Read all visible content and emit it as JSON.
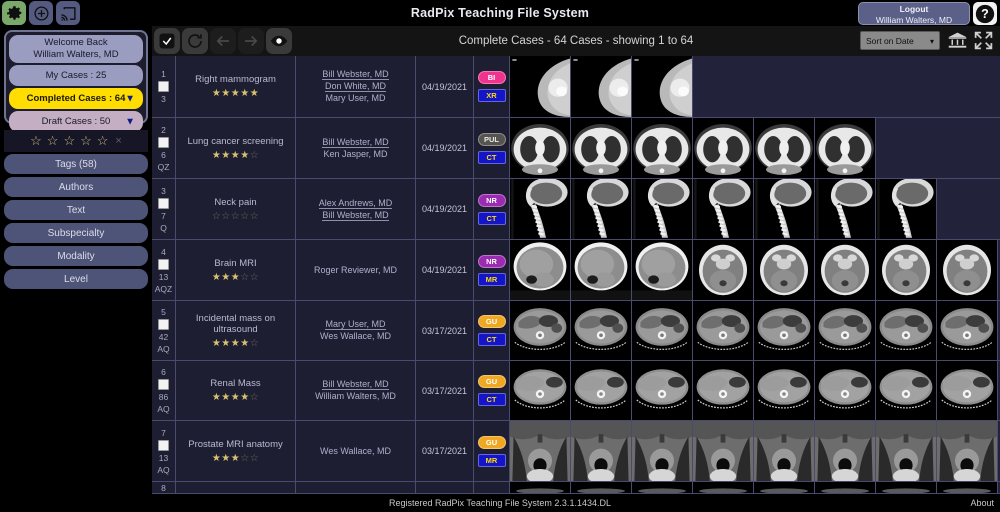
{
  "header": {
    "title": "RadPix Teaching File System",
    "icons": [
      "gear-icon",
      "add-circle-icon",
      "cast-icon"
    ],
    "logout_label": "Logout",
    "logout_user": "William Walters, MD",
    "help_label": "?"
  },
  "sidebar": {
    "welcome_line1": "Welcome Back",
    "welcome_line2": "William Walters, MD",
    "my_cases": "My Cases : 25",
    "completed_cases": "Completed Cases : 64",
    "draft_cases": "Draft Cases : 50",
    "rating_stars": 5,
    "clear_rating": "×",
    "filters": [
      {
        "label": "Tags (58)"
      },
      {
        "label": "Authors"
      },
      {
        "label": "Text"
      },
      {
        "label": "Subspecialty"
      },
      {
        "label": "Modality"
      },
      {
        "label": "Level"
      }
    ]
  },
  "toolbar": {
    "title": "Complete Cases - 64 Cases - showing 1 to 64",
    "sort_label": "Sort on Date",
    "buttons": [
      "select-all-icon",
      "refresh-icon",
      "back-arrow-icon",
      "forward-arrow-icon",
      "preview-eye-icon"
    ],
    "right_buttons": [
      "bank-icon",
      "fullscreen-icon"
    ]
  },
  "colors": {
    "accent_yellow": "#ffdd00",
    "badge_bi": "#f0338f",
    "badge_xr": "#1414c8",
    "badge_pul": "#55544e",
    "badge_ct": "#1414c8",
    "badge_nr": "#9b2bb0",
    "badge_mr": "#1414c8",
    "badge_gu": "#f0a823",
    "row_bg": "#23233c",
    "grid": "#4a4a6e"
  },
  "rows": [
    {
      "num": "1",
      "count": "3",
      "flags": "",
      "title": "Right mammogram",
      "stars": 5,
      "authors": [
        {
          "name": "Bill Webster, MD",
          "underline": true
        },
        {
          "name": "Don White, MD",
          "underline": true
        },
        {
          "name": "Mary User, MD",
          "underline": false
        }
      ],
      "date": "04/19/2021",
      "badges": [
        {
          "text": "BI",
          "bg": "#f0338f",
          "fg": "#ffffff",
          "shape": "pill"
        },
        {
          "text": "XR",
          "bg": "#1414c8",
          "fg": "#ffdd00",
          "shape": "sq"
        }
      ],
      "thumb_count": 3,
      "thumb_kind": "mammogram"
    },
    {
      "num": "2",
      "count": "6",
      "flags": "QZ",
      "title": "Lung cancer screening",
      "stars": 4,
      "authors": [
        {
          "name": "Bill Webster, MD",
          "underline": true
        },
        {
          "name": "Ken Jasper, MD",
          "underline": false
        }
      ],
      "date": "04/19/2021",
      "badges": [
        {
          "text": "PUL",
          "bg": "#55544e",
          "fg": "#e8e8e8",
          "shape": "pill"
        },
        {
          "text": "CT",
          "bg": "#1414c8",
          "fg": "#ffdd00",
          "shape": "sq"
        }
      ],
      "thumb_count": 6,
      "thumb_kind": "chest-ct"
    },
    {
      "num": "3",
      "count": "7",
      "flags": "Q",
      "title": "Neck pain",
      "stars": 0,
      "authors": [
        {
          "name": "Alex Andrews, MD",
          "underline": true
        },
        {
          "name": "Bill Webster, MD",
          "underline": true
        }
      ],
      "date": "04/19/2021",
      "badges": [
        {
          "text": "NR",
          "bg": "#9b2bb0",
          "fg": "#ffffff",
          "shape": "pill"
        },
        {
          "text": "CT",
          "bg": "#1414c8",
          "fg": "#ffdd00",
          "shape": "sq"
        }
      ],
      "thumb_count": 7,
      "thumb_kind": "spine-sag"
    },
    {
      "num": "4",
      "count": "13",
      "flags": "AQZ",
      "title": "Brain MRI",
      "stars": 3,
      "authors": [
        {
          "name": "Roger Reviewer, MD",
          "underline": false
        }
      ],
      "date": "04/19/2021",
      "badges": [
        {
          "text": "NR",
          "bg": "#9b2bb0",
          "fg": "#ffffff",
          "shape": "pill"
        },
        {
          "text": "MR",
          "bg": "#1414c8",
          "fg": "#ffdd00",
          "shape": "sq"
        }
      ],
      "thumb_count": 8,
      "thumb_kind": "brain-mri"
    },
    {
      "num": "5",
      "count": "42",
      "flags": "AQ",
      "title": "Incidental mass on ultrasound",
      "stars": 4,
      "authors": [
        {
          "name": "Mary User, MD",
          "underline": true
        },
        {
          "name": "Wes Wallace, MD",
          "underline": false
        }
      ],
      "date": "03/17/2021",
      "badges": [
        {
          "text": "GU",
          "bg": "#f0a823",
          "fg": "#ffffff",
          "shape": "pill"
        },
        {
          "text": "CT",
          "bg": "#1414c8",
          "fg": "#ffdd00",
          "shape": "sq"
        }
      ],
      "thumb_count": 8,
      "thumb_kind": "abdomen-ct"
    },
    {
      "num": "6",
      "count": "86",
      "flags": "AQ",
      "title": "Renal Mass",
      "stars": 4,
      "authors": [
        {
          "name": "Bill Webster, MD",
          "underline": true
        },
        {
          "name": "William Walters, MD",
          "underline": false
        }
      ],
      "date": "03/17/2021",
      "badges": [
        {
          "text": "GU",
          "bg": "#f0a823",
          "fg": "#ffffff",
          "shape": "pill"
        },
        {
          "text": "CT",
          "bg": "#1414c8",
          "fg": "#ffdd00",
          "shape": "sq"
        }
      ],
      "thumb_count": 8,
      "thumb_kind": "liver-ct"
    },
    {
      "num": "7",
      "count": "13",
      "flags": "AQ",
      "title": "Prostate MRI anatomy",
      "stars": 3,
      "authors": [
        {
          "name": "Wes Wallace, MD",
          "underline": false
        }
      ],
      "date": "03/17/2021",
      "badges": [
        {
          "text": "GU",
          "bg": "#f0a823",
          "fg": "#ffffff",
          "shape": "pill"
        },
        {
          "text": "MR",
          "bg": "#1414c8",
          "fg": "#ffdd00",
          "shape": "sq"
        }
      ],
      "thumb_count": 8,
      "thumb_kind": "pelvis-mri"
    },
    {
      "num": "8",
      "count": "",
      "flags": "",
      "title": "",
      "stars": 0,
      "authors": [],
      "date": "",
      "badges": [],
      "thumb_count": 8,
      "thumb_kind": "partial"
    }
  ],
  "footer": {
    "text": "Registered RadPix Teaching File System 2.3.1.1434.DL",
    "about": "About"
  }
}
